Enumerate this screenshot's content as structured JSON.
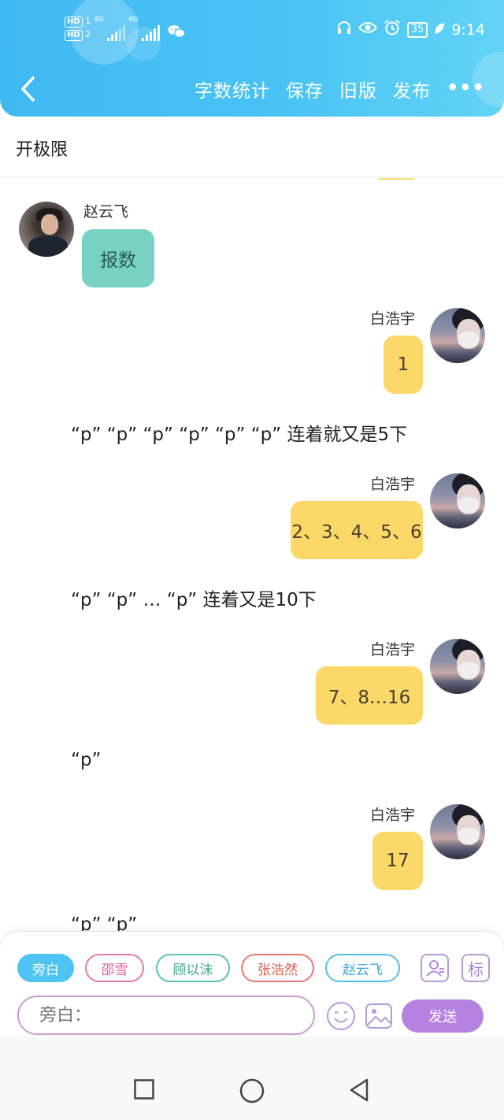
{
  "status_bar": {
    "hd1": "HD",
    "sim1": "1",
    "net1": "4G",
    "hd2": "HD",
    "sim2": "2",
    "net2": "4G",
    "battery": "35",
    "time": "9:14"
  },
  "header": {
    "actions": [
      "字数统计",
      "保存",
      "旧版",
      "发布"
    ],
    "more_label": "•••"
  },
  "title": "开极限",
  "messages": [
    {
      "type": "bubble",
      "side": "left",
      "speaker": "赵云飞",
      "text": "报数",
      "color": "#78d2c3"
    },
    {
      "type": "bubble",
      "side": "right",
      "speaker": "白浩宇",
      "text": "1",
      "color": "#fbd867"
    },
    {
      "type": "narration",
      "text": "“p” “p” “p” “p” “p” “p” 连着就又是5下"
    },
    {
      "type": "bubble",
      "side": "right",
      "speaker": "白浩宇",
      "text": "2、3、4、5、6",
      "color": "#fbd867"
    },
    {
      "type": "narration",
      "text": "“p” “p” … “p” 连着又是10下"
    },
    {
      "type": "bubble",
      "side": "right",
      "speaker": "白浩宇",
      "text": "7、8…16",
      "color": "#fbd867"
    },
    {
      "type": "narration",
      "text": "“p”"
    },
    {
      "type": "bubble",
      "side": "right",
      "speaker": "白浩宇",
      "text": "17",
      "color": "#fbd867"
    },
    {
      "type": "narration",
      "text": "“p” “p”"
    }
  ],
  "composer": {
    "role_chips": [
      "旁白",
      "邵雪",
      "顾以沫",
      "张浩然",
      "赵云飞"
    ],
    "active_role": "旁白",
    "tag_label": "标",
    "input_placeholder": "旁白：",
    "send_label": "发送"
  }
}
